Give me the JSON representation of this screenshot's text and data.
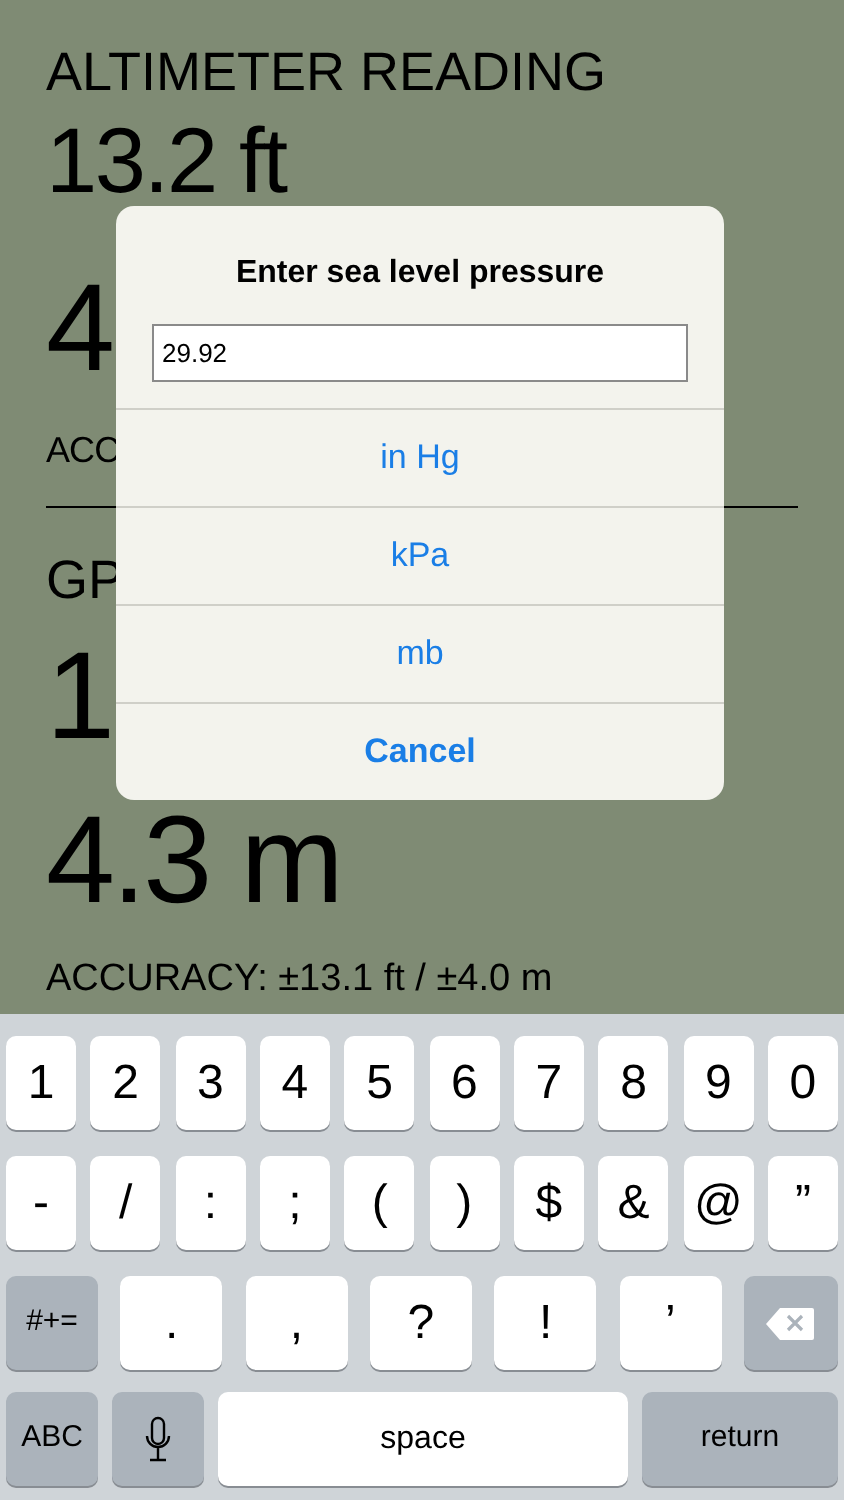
{
  "screen": {
    "altimeter_title": "ALTIMETER READING",
    "altimeter_feet": "13.2 ft",
    "altimeter_meters": "4",
    "altimeter_accuracy": "ACC",
    "gps_title": "GP",
    "gps_feet": "1",
    "gps_meters": "4.3 m",
    "gps_accuracy": "ACCURACY: ±13.1 ft / ±4.0 m"
  },
  "dialog": {
    "title": "Enter sea level pressure",
    "field_value": "29.92",
    "options": [
      {
        "label": "in Hg",
        "kind": "option"
      },
      {
        "label": "kPa",
        "kind": "option"
      },
      {
        "label": "mb",
        "kind": "option"
      },
      {
        "label": "Cancel",
        "kind": "cancel"
      }
    ]
  },
  "keyboard": {
    "row_1": [
      "1",
      "2",
      "3",
      "4",
      "5",
      "6",
      "7",
      "8",
      "9",
      "0"
    ],
    "row_2": [
      "-",
      "/",
      ":",
      ";",
      "(",
      ")",
      "$",
      "&",
      "@",
      "”"
    ],
    "row_3": [
      {
        "label": "#+=",
        "kind": "modifier"
      },
      {
        "label": ".",
        "kind": "char"
      },
      {
        "label": ",",
        "kind": "char"
      },
      {
        "label": "?",
        "kind": "char"
      },
      {
        "label": "!",
        "kind": "char"
      },
      {
        "label": "’",
        "kind": "char"
      },
      {
        "kind": "delete"
      }
    ],
    "row_4": [
      {
        "label": "ABC",
        "kind": "modifier"
      },
      {
        "kind": "mic"
      },
      {
        "label": "space",
        "kind": "space"
      },
      {
        "label": "return",
        "kind": "modifier"
      }
    ]
  }
}
